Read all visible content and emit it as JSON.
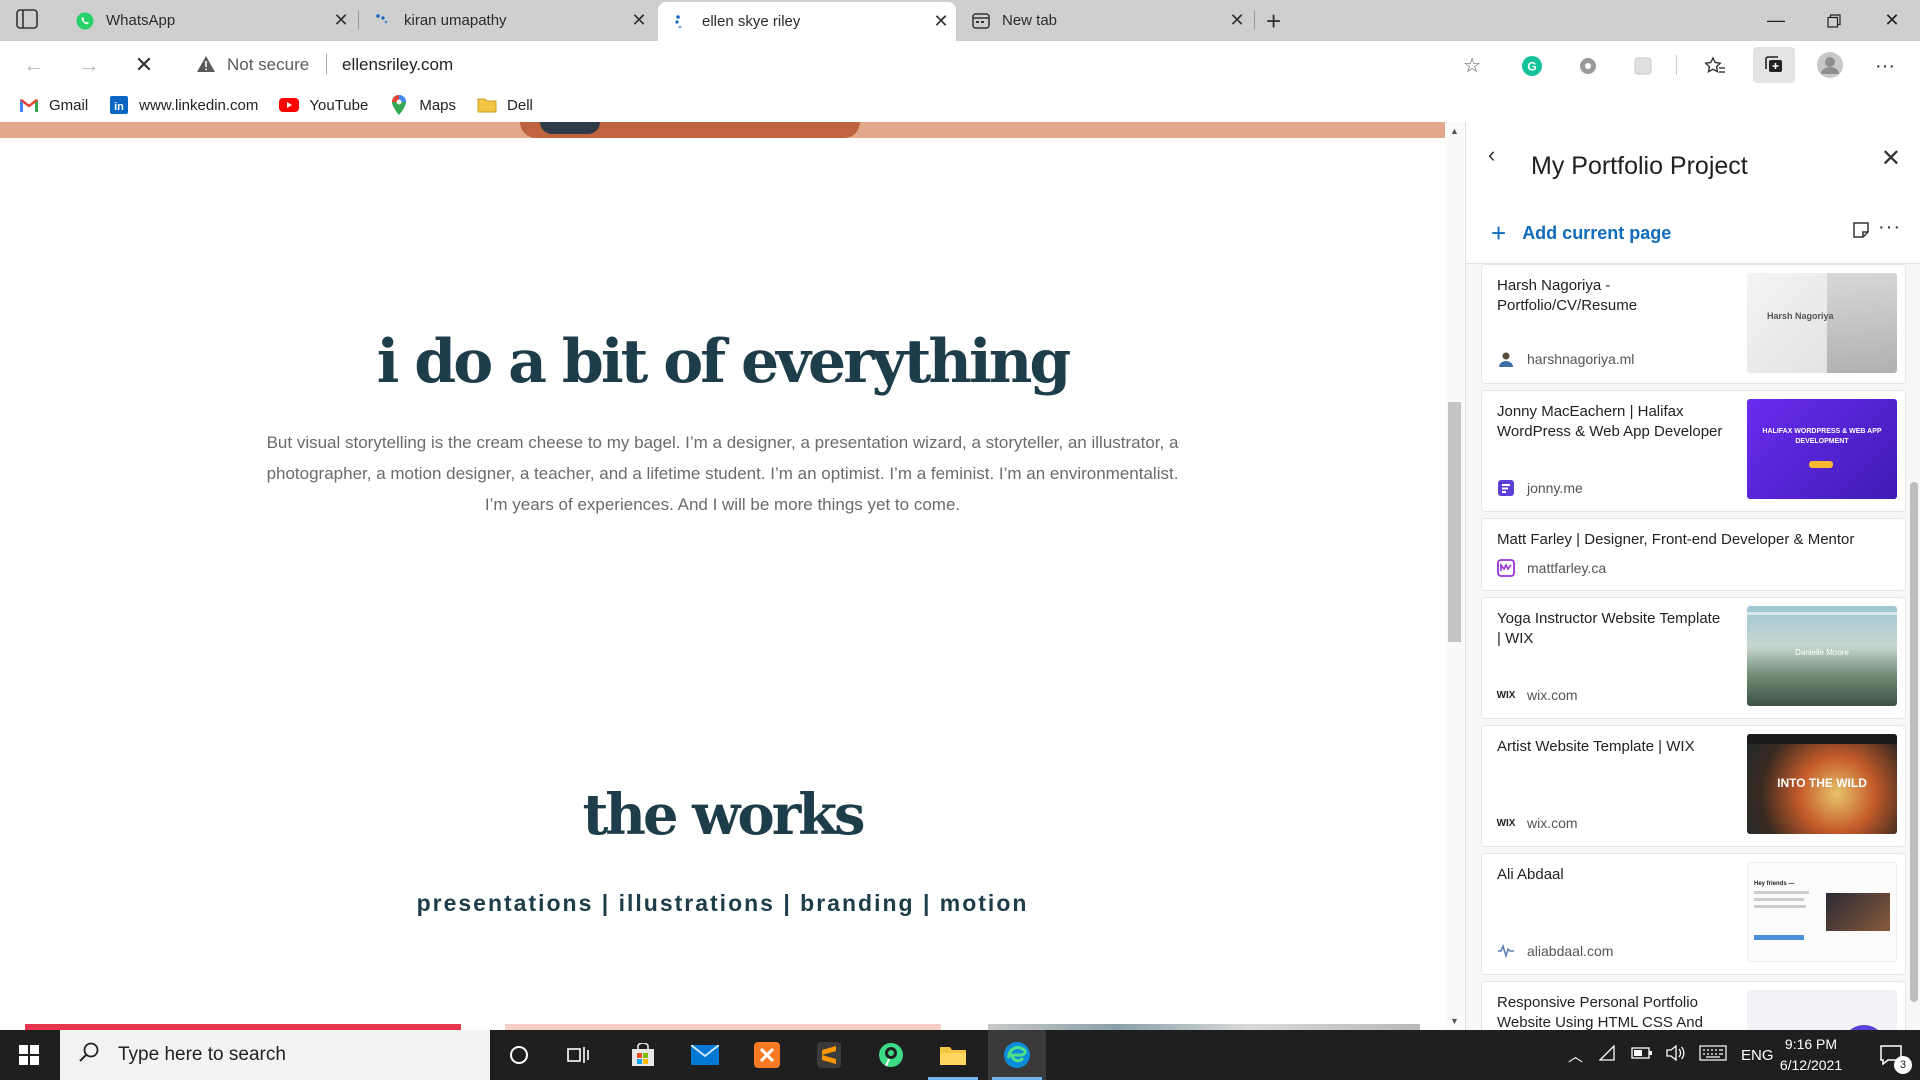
{
  "browser": {
    "tabs": [
      {
        "label": "WhatsApp",
        "icon": "whatsapp-icon",
        "active": false
      },
      {
        "label": "kiran umapathy",
        "icon": "loading-dots-icon",
        "active": false
      },
      {
        "label": "ellen skye riley",
        "icon": "loading-dots-icon",
        "active": true
      },
      {
        "label": "New tab",
        "icon": "newtab-icon",
        "active": false
      }
    ],
    "address": {
      "security": "Not secure",
      "url": "ellensriley.com"
    },
    "bookmarks": [
      {
        "label": "Gmail",
        "icon": "gmail-icon"
      },
      {
        "label": "www.linkedin.com",
        "icon": "linkedin-icon"
      },
      {
        "label": "YouTube",
        "icon": "youtube-icon"
      },
      {
        "label": "Maps",
        "icon": "maps-icon"
      },
      {
        "label": "Dell",
        "icon": "folder-icon"
      }
    ]
  },
  "page": {
    "headline": "i do a bit of everything",
    "bio": "But visual storytelling is the cream cheese to my bagel. I’m a designer, a presentation wizard, a storyteller, an illustrator, a photographer, a motion designer, a teacher, and a lifetime student. I’m an optimist. I’m a feminist. I’m an environmentalist. I’m years of experiences. And I will be more things yet to come.",
    "works_title": "the works",
    "categories": "presentations | illustrations | branding | motion"
  },
  "collection": {
    "title": "My Portfolio Project",
    "add_label": "Add current page",
    "items": [
      {
        "title": "Harsh Nagoriya - Portfolio/CV/Resume",
        "source": "harshnagoriya.ml",
        "thumb_text": "Harsh Nagoriya"
      },
      {
        "title": "Jonny MacEachern | Halifax WordPress & Web App Developer",
        "source": "jonny.me",
        "thumb_text": "HALIFAX WORDPRESS & WEB APP DEVELOPMENT"
      },
      {
        "title": "Matt Farley | Designer, Front-end Developer & Mentor",
        "source": "mattfarley.ca"
      },
      {
        "title": "Yoga Instructor Website Template | WIX",
        "source": "wix.com",
        "thumb_text": "Danielle Moore"
      },
      {
        "title": "Artist Website Template | WIX",
        "source": "wix.com",
        "thumb_text": "INTO THE WILD"
      },
      {
        "title": "Ali Abdaal",
        "source": "aliabdaal.com",
        "thumb_text": "Hey friends —"
      },
      {
        "title": "Responsive Personal Portfolio Website Using HTML CSS And",
        "source": ""
      }
    ]
  },
  "taskbar": {
    "search_placeholder": "Type here to search",
    "language": "ENG",
    "time": "9:16 PM",
    "date": "6/12/2021",
    "notifications": "3"
  },
  "colors": {
    "headline": "#1e3d4a",
    "link_blue": "#0f6cbd",
    "hero_peach": "#e3a88b",
    "card_red": "#e8344e",
    "card_pink": "#f5cfc6"
  }
}
